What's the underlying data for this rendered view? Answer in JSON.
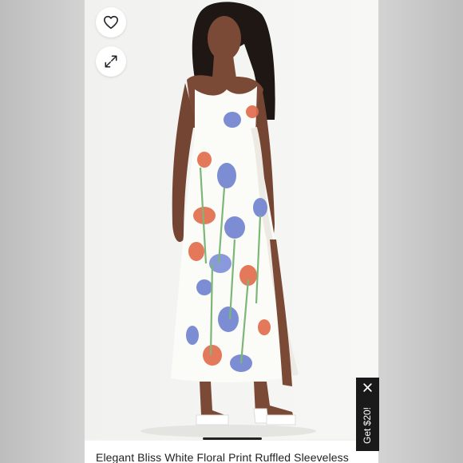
{
  "listing": {
    "title": "Elegant Bliss White Floral Print Ruffled Sleeveless"
  },
  "icons": {
    "like": "heart-icon",
    "fullscreen": "expand-icon",
    "close": "close-icon"
  },
  "promo": {
    "label": "Get $20!"
  }
}
